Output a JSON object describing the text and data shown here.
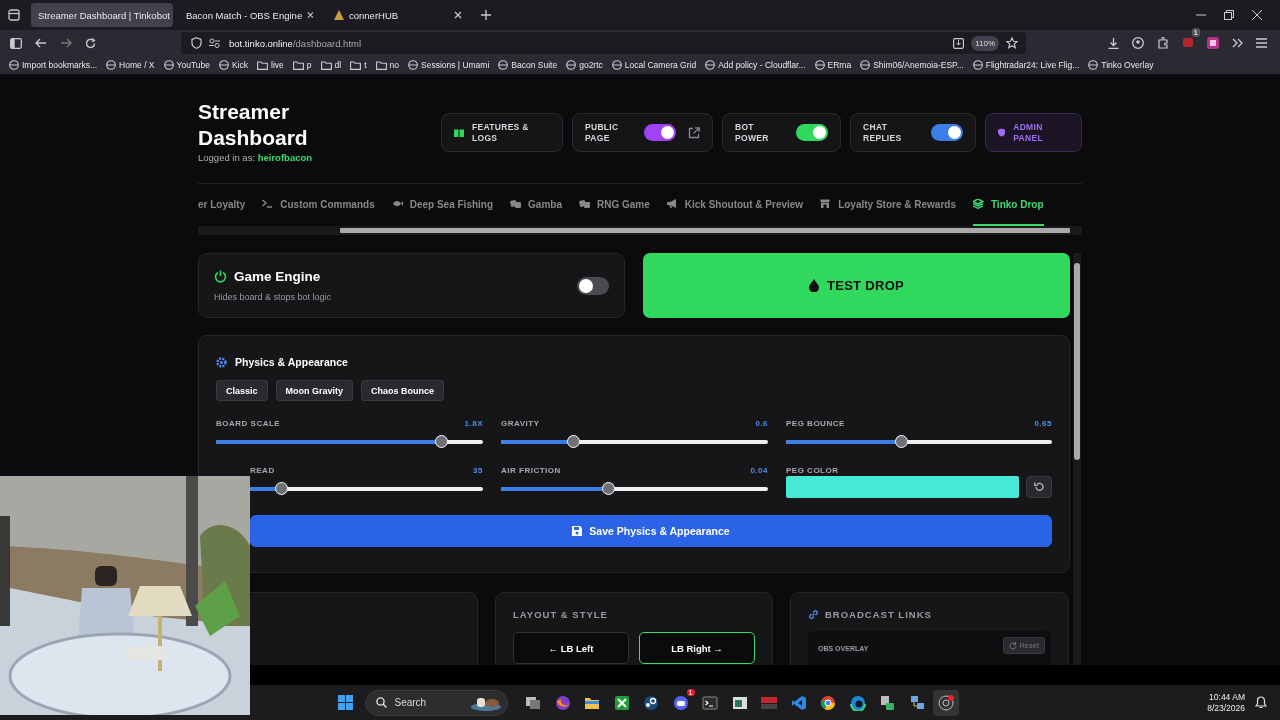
{
  "browser": {
    "tabs": [
      {
        "title": "Streamer Dashboard | Tinkobot",
        "selected": true
      },
      {
        "title": "Bacon Match - OBS Engine",
        "selected": false
      },
      {
        "title": "connerHUB",
        "selected": false
      }
    ],
    "url_host": "bot.tinko.online",
    "url_path": "/dashboard.html",
    "zoom": "110%",
    "extension_badge": "1",
    "bookmarks": [
      {
        "label": "Import bookmarks...",
        "kind": "site"
      },
      {
        "label": "Home / X",
        "kind": "site"
      },
      {
        "label": "YouTube",
        "kind": "site"
      },
      {
        "label": "Kick",
        "kind": "site"
      },
      {
        "label": "live",
        "kind": "folder"
      },
      {
        "label": "p",
        "kind": "folder"
      },
      {
        "label": "dl",
        "kind": "folder"
      },
      {
        "label": "t",
        "kind": "folder"
      },
      {
        "label": "no",
        "kind": "folder"
      },
      {
        "label": "Sessions | Umami",
        "kind": "site"
      },
      {
        "label": "Bacon Suite",
        "kind": "site"
      },
      {
        "label": "go2rtc",
        "kind": "site"
      },
      {
        "label": "Local Camera Grid",
        "kind": "site"
      },
      {
        "label": "Add policy - Cloudflar...",
        "kind": "site"
      },
      {
        "label": "ERma",
        "kind": "site"
      },
      {
        "label": "Shim06/Anemoia-ESP...",
        "kind": "site"
      },
      {
        "label": "Flightradar24: Live Flig...",
        "kind": "site"
      },
      {
        "label": "Tinko Overlay",
        "kind": "site"
      }
    ]
  },
  "header": {
    "title": "Streamer Dashboard",
    "logged_in_label": "Logged in as:",
    "username": "heirofbacon",
    "controls": [
      {
        "kind": "link",
        "label": "FEATURES & LOGS"
      },
      {
        "kind": "toggle",
        "label": "PUBLIC PAGE",
        "on": true,
        "color": "#a142f4",
        "external_link": true
      },
      {
        "kind": "toggle",
        "label": "BOT POWER",
        "on": true,
        "color": "#31d85e",
        "external_link": false
      },
      {
        "kind": "toggle",
        "label": "CHAT REPLIES",
        "on": true,
        "color": "#3b7ee8",
        "external_link": false
      },
      {
        "kind": "admin",
        "label": "ADMIN PANEL"
      }
    ]
  },
  "nav_tabs": [
    {
      "label": "er Loyalty",
      "selected": false
    },
    {
      "label": "Custom Commands",
      "selected": false
    },
    {
      "label": "Deep Sea Fishing",
      "selected": false
    },
    {
      "label": "Gamba",
      "selected": false
    },
    {
      "label": "RNG Game",
      "selected": false
    },
    {
      "label": "Kick Shoutout & Preview",
      "selected": false
    },
    {
      "label": "Loyalty Store & Rewards",
      "selected": false
    },
    {
      "label": "Tinko Drop",
      "selected": true
    }
  ],
  "game_engine": {
    "title": "Game Engine",
    "subtitle": "Hides board & stops bot logic",
    "on": false
  },
  "test_drop": {
    "label": "TEST DROP"
  },
  "physics": {
    "title": "Physics & Appearance",
    "presets": [
      "Classic",
      "Moon Gravity",
      "Chaos Bounce"
    ],
    "sliders": [
      {
        "label": "BOARD SCALE",
        "value": "1.8X",
        "level": 0.846
      },
      {
        "label": "GRAVITY",
        "value": "0.6",
        "level": 0.273
      },
      {
        "label": "PEG BOUNCE",
        "value": "0.65",
        "level": 0.436
      },
      {
        "label": "READ",
        "value": "35",
        "level": 0.137
      },
      {
        "label": "AIR FRICTION",
        "value": "0.04",
        "level": 0.404
      }
    ],
    "peg_color": {
      "label": "PEG COLOR",
      "color": "#48e8d6"
    },
    "save_label": "Save Physics & Appearance"
  },
  "layout_style": {
    "title": "LAYOUT & STYLE",
    "buttons": [
      {
        "label": "← LB Left",
        "selected": false
      },
      {
        "label": "LB Right →",
        "selected": true
      }
    ]
  },
  "broadcast_links": {
    "title": "BROADCAST LINKS",
    "items": [
      {
        "label": "OBS OVERLAY",
        "action": "Reset"
      }
    ]
  },
  "taskbar": {
    "search_placeholder": "Search",
    "chat_badge": "1",
    "time": "10:44 AM",
    "date": "8/23/2026"
  }
}
